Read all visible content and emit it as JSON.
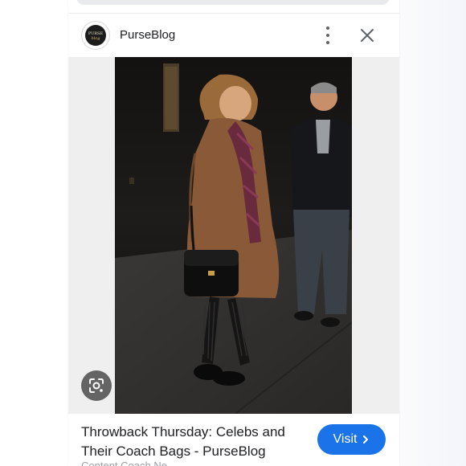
{
  "source": {
    "name": "PurseBlog",
    "logo_text": "PURSE blog"
  },
  "result": {
    "title": "Throwback Thursday: Celebs and Their Coach Bags - PurseBlog",
    "visit_label": "Visit",
    "partial_caption": "Content Coach Ne..."
  },
  "icons": {
    "more": "more-vert-icon",
    "close": "close-icon",
    "visit_arrow": "chevron-right-icon",
    "lens": "google-lens-icon"
  },
  "colors": {
    "accent": "#1a73e8",
    "text": "#202124",
    "muted": "#5f6368"
  }
}
